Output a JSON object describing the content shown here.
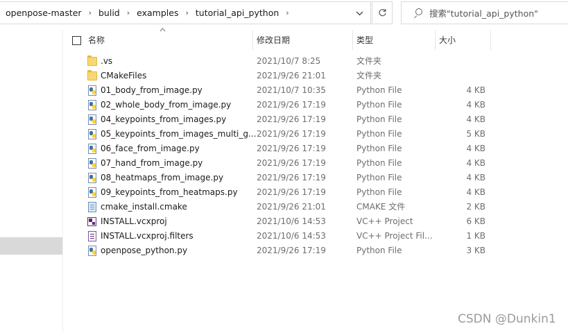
{
  "breadcrumb": {
    "items": [
      "openpose-master",
      "bulid",
      "examples",
      "tutorial_api_python"
    ],
    "separator": "›",
    "dropdown_icon": "chevron-down-icon",
    "refresh_icon": "refresh-icon"
  },
  "search": {
    "text": "搜索\"tutorial_api_python\"",
    "icon": "search-icon"
  },
  "columns": {
    "name": "名称",
    "date": "修改日期",
    "type": "类型",
    "size": "大小"
  },
  "files": [
    {
      "name": ".vs",
      "date": "2021/10/7 8:25",
      "type": "文件夹",
      "size": "",
      "icon": "folder-icon"
    },
    {
      "name": "CMakeFiles",
      "date": "2021/9/26 21:01",
      "type": "文件夹",
      "size": "",
      "icon": "folder-icon"
    },
    {
      "name": "01_body_from_image.py",
      "date": "2021/10/7 10:35",
      "type": "Python File",
      "size": "4 KB",
      "icon": "python-file-icon"
    },
    {
      "name": "02_whole_body_from_image.py",
      "date": "2021/9/26 17:19",
      "type": "Python File",
      "size": "4 KB",
      "icon": "python-file-icon"
    },
    {
      "name": "04_keypoints_from_images.py",
      "date": "2021/9/26 17:19",
      "type": "Python File",
      "size": "4 KB",
      "icon": "python-file-icon"
    },
    {
      "name": "05_keypoints_from_images_multi_g...",
      "date": "2021/9/26 17:19",
      "type": "Python File",
      "size": "5 KB",
      "icon": "python-file-icon"
    },
    {
      "name": "06_face_from_image.py",
      "date": "2021/9/26 17:19",
      "type": "Python File",
      "size": "4 KB",
      "icon": "python-file-icon"
    },
    {
      "name": "07_hand_from_image.py",
      "date": "2021/9/26 17:19",
      "type": "Python File",
      "size": "4 KB",
      "icon": "python-file-icon"
    },
    {
      "name": "08_heatmaps_from_image.py",
      "date": "2021/9/26 17:19",
      "type": "Python File",
      "size": "4 KB",
      "icon": "python-file-icon"
    },
    {
      "name": "09_keypoints_from_heatmaps.py",
      "date": "2021/9/26 17:19",
      "type": "Python File",
      "size": "4 KB",
      "icon": "python-file-icon"
    },
    {
      "name": "cmake_install.cmake",
      "date": "2021/9/26 21:01",
      "type": "CMAKE 文件",
      "size": "2 KB",
      "icon": "cmake-file-icon"
    },
    {
      "name": "INSTALL.vcxproj",
      "date": "2021/10/6 14:53",
      "type": "VC++ Project",
      "size": "6 KB",
      "icon": "vcxproj-file-icon"
    },
    {
      "name": "INSTALL.vcxproj.filters",
      "date": "2021/10/6 14:53",
      "type": "VC++ Project Fil...",
      "size": "1 KB",
      "icon": "vcxproj-filters-icon"
    },
    {
      "name": "openpose_python.py",
      "date": "2021/9/26 17:19",
      "type": "Python File",
      "size": "3 KB",
      "icon": "python-file-icon"
    }
  ],
  "watermark": "CSDN @Dunkin1"
}
